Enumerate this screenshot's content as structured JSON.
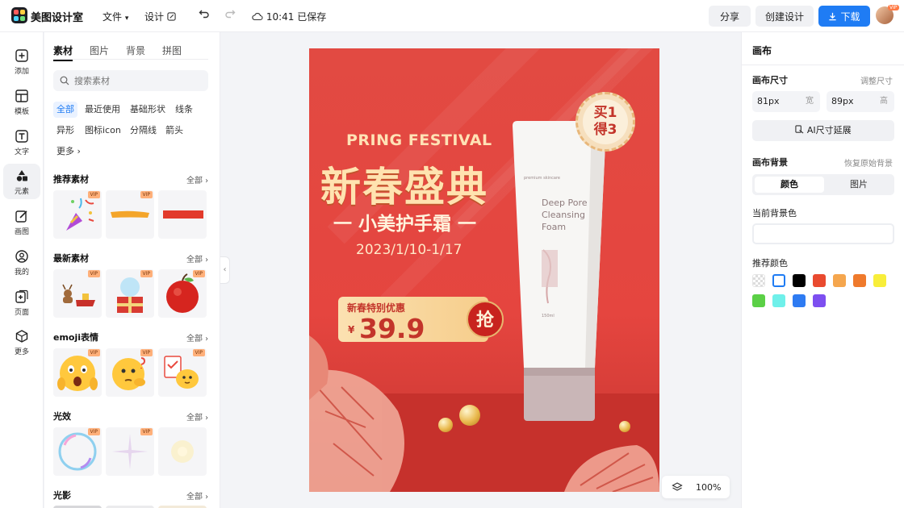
{
  "app": {
    "name": "美图设计室"
  },
  "topbar": {
    "menu_file": "文件",
    "menu_design": "设计",
    "save_status": "10:41 已保存",
    "share_label": "分享",
    "create_label": "创建设计",
    "download_label": "下载",
    "avatar_badge": "VIP"
  },
  "leftnav": {
    "items": [
      {
        "label": "添加",
        "icon": "plus-square-icon"
      },
      {
        "label": "模板",
        "icon": "template-icon"
      },
      {
        "label": "文字",
        "icon": "text-icon"
      },
      {
        "label": "元素",
        "icon": "shapes-icon"
      },
      {
        "label": "画图",
        "icon": "draw-icon"
      },
      {
        "label": "我的",
        "icon": "user-icon"
      },
      {
        "label": "页面",
        "icon": "page-add-icon"
      },
      {
        "label": "更多",
        "icon": "cube-icon"
      }
    ]
  },
  "panel": {
    "tabs": [
      "素材",
      "图片",
      "背景",
      "拼图"
    ],
    "search_placeholder": "搜索素材",
    "chips": [
      "全部",
      "最近使用",
      "基础形状",
      "线条",
      "异形",
      "图标icon",
      "分隔线",
      "箭头",
      "更多"
    ],
    "more_arrow": "›",
    "all_label": "全部 ›",
    "vip_label": "VIP",
    "sections": [
      {
        "title": "推荐素材"
      },
      {
        "title": "最新素材"
      },
      {
        "title": "emoji表情"
      },
      {
        "title": "光效"
      },
      {
        "title": "光影"
      }
    ]
  },
  "poster": {
    "subtitle": "PRING FESTIVAL",
    "title": "新春盛典",
    "product": "一 小美护手霜 一",
    "date": "2023/1/10-1/17",
    "price_label": "新春特别优惠",
    "price_currency": "¥",
    "price_value": "39.9",
    "grab_label": "抢",
    "badge_line1": "买1",
    "badge_line2": "得3",
    "tube_brand": "premium skincare",
    "tube_text": "Deep Pore Cleansing Foam",
    "tube_volume": "150ml"
  },
  "canvas_toolbar": {
    "zoom": "100%"
  },
  "rpanel": {
    "title": "画布",
    "size_label": "画布尺寸",
    "size_link": "调整尺寸",
    "width_value": "81px",
    "width_unit": "宽",
    "height_value": "89px",
    "height_unit": "高",
    "ai_button": "AI尺寸延展",
    "bg_label": "画布背景",
    "bg_reset": "恢复原始背景",
    "seg_color": "颜色",
    "seg_image": "图片",
    "current_bg_label": "当前背景色",
    "recommend_label": "推荐颜色",
    "colors": [
      "transparent",
      "#ffffff",
      "#000000",
      "#e94a2f",
      "#f5a64e",
      "#ef7a2c",
      "#f8ee3a",
      "#5bd046",
      "#6ff0ea",
      "#2e7bf2",
      "#7d4ff0"
    ]
  }
}
